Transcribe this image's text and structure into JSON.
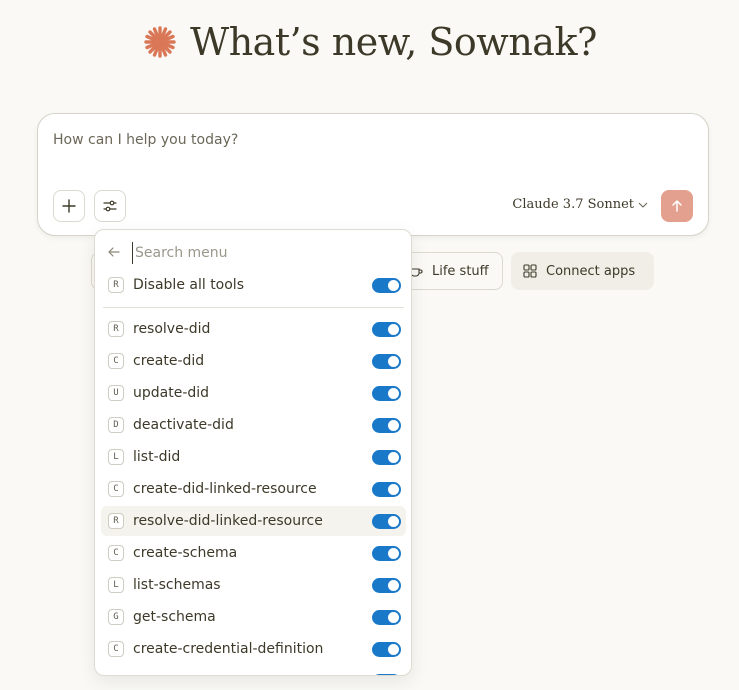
{
  "greeting": {
    "text": "What’s new, Sownak?",
    "accent_color": "#d97757",
    "icon": "sparkle-icon"
  },
  "composer": {
    "placeholder": "How can I help you today?",
    "model_label": "Claude 3.7 Sonnet",
    "send_color": "#e4a08f",
    "buttons": [
      "plus-icon",
      "sliders-icon",
      "arrow-up-icon"
    ]
  },
  "chips": {
    "life_stuff": "Life stuff",
    "connect_apps": "Connect apps"
  },
  "menu": {
    "search_placeholder": "Search menu",
    "disable_all": {
      "badge": "R",
      "label": "Disable all tools",
      "on": true
    },
    "tools": [
      {
        "badge": "R",
        "label": "resolve-did",
        "on": true
      },
      {
        "badge": "C",
        "label": "create-did",
        "on": true
      },
      {
        "badge": "U",
        "label": "update-did",
        "on": true
      },
      {
        "badge": "D",
        "label": "deactivate-did",
        "on": true
      },
      {
        "badge": "L",
        "label": "list-did",
        "on": true
      },
      {
        "badge": "C",
        "label": "create-did-linked-resource",
        "on": true
      },
      {
        "badge": "R",
        "label": "resolve-did-linked-resource",
        "on": true
      },
      {
        "badge": "C",
        "label": "create-schema",
        "on": true
      },
      {
        "badge": "L",
        "label": "list-schemas",
        "on": true
      },
      {
        "badge": "G",
        "label": "get-schema",
        "on": true
      },
      {
        "badge": "C",
        "label": "create-credential-definition",
        "on": true
      }
    ],
    "toggle_color": "#1a78c9"
  }
}
